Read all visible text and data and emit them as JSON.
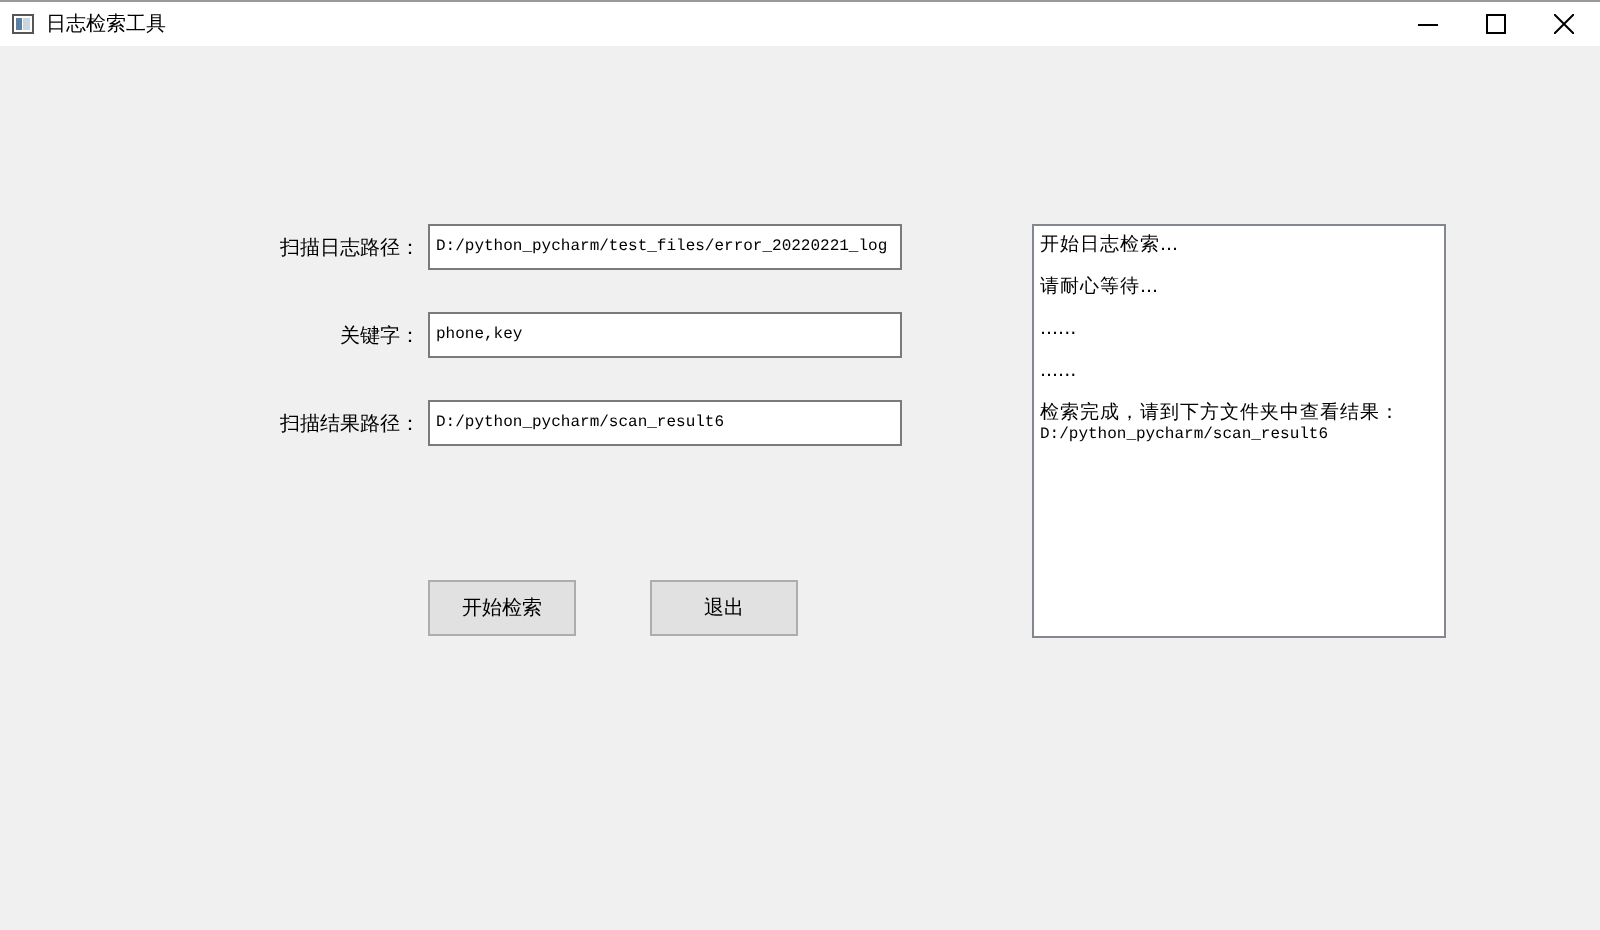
{
  "window": {
    "title": "日志检索工具",
    "controls": [
      {
        "kind": "minimize"
      },
      {
        "kind": "maximize"
      },
      {
        "kind": "close"
      }
    ]
  },
  "form": {
    "fields": [
      {
        "label": "扫描日志路径：",
        "value": "D:/python_pycharm/test_files/error_20220221_log"
      },
      {
        "label": "关键字：",
        "value": "phone,key"
      },
      {
        "label": "扫描结果路径：",
        "value": "D:/python_pycharm/scan_result6"
      }
    ],
    "buttons": [
      "开始检索",
      "退出"
    ]
  },
  "output": {
    "paragraphs": [
      [
        "开始日志检索..."
      ],
      [
        "请耐心等待..."
      ],
      [
        "......"
      ],
      [
        "......"
      ],
      [
        "检索完成，请到下方文件夹中查看结果：",
        "D:/python_pycharm/scan_result6"
      ]
    ]
  }
}
